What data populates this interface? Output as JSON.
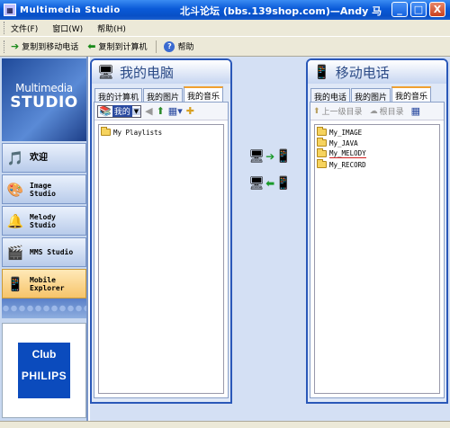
{
  "window": {
    "app_title": "Multimedia Studio",
    "forum_title": "北斗论坛 (bbs.139shop.com)—Andy 马",
    "minimize": "_",
    "maximize": "□",
    "close": "X"
  },
  "menu": {
    "file": "文件(F)",
    "window": "窗口(W)",
    "help": "帮助(H)"
  },
  "toolbar": {
    "copy_to_phone": "复制到移动电话",
    "copy_to_pc": "复制到计算机",
    "help": "帮助"
  },
  "logo": {
    "line1": "Multimedia",
    "line2": "STUDIO"
  },
  "nav": [
    {
      "label": "欢迎",
      "icon": "welcome-icon"
    },
    {
      "label": "Image\nStudio",
      "icon": "image-palette-icon"
    },
    {
      "label": "Melody\nStudio",
      "icon": "bell-icon"
    },
    {
      "label": "MMS Studio",
      "icon": "clapperboard-icon"
    },
    {
      "label": "Mobile\nExplorer",
      "icon": "phone-icon",
      "active": true
    }
  ],
  "club": {
    "line1": "Club",
    "line2": "PHILIPS"
  },
  "pc_panel": {
    "title": "我的电脑",
    "tabs": [
      "我的计算机",
      "我的图片",
      "我的音乐"
    ],
    "active_tab": "我的音乐",
    "dropdown_value": "我的",
    "items": [
      "My Playlists"
    ]
  },
  "phone_panel": {
    "title": "移动电话",
    "tabs": [
      "我的电话",
      "我的图片",
      "我的音乐"
    ],
    "active_tab": "我的音乐",
    "up_label": "上一级目录",
    "root_label": "根目录",
    "items": [
      "My_IMAGE",
      "My_JAVA",
      "My_MELODY",
      "My_RECORD"
    ]
  },
  "colors": {
    "title_blue": "#0a5ad8",
    "panel_border": "#2a58b8",
    "active_nav": "#f6c46a"
  }
}
